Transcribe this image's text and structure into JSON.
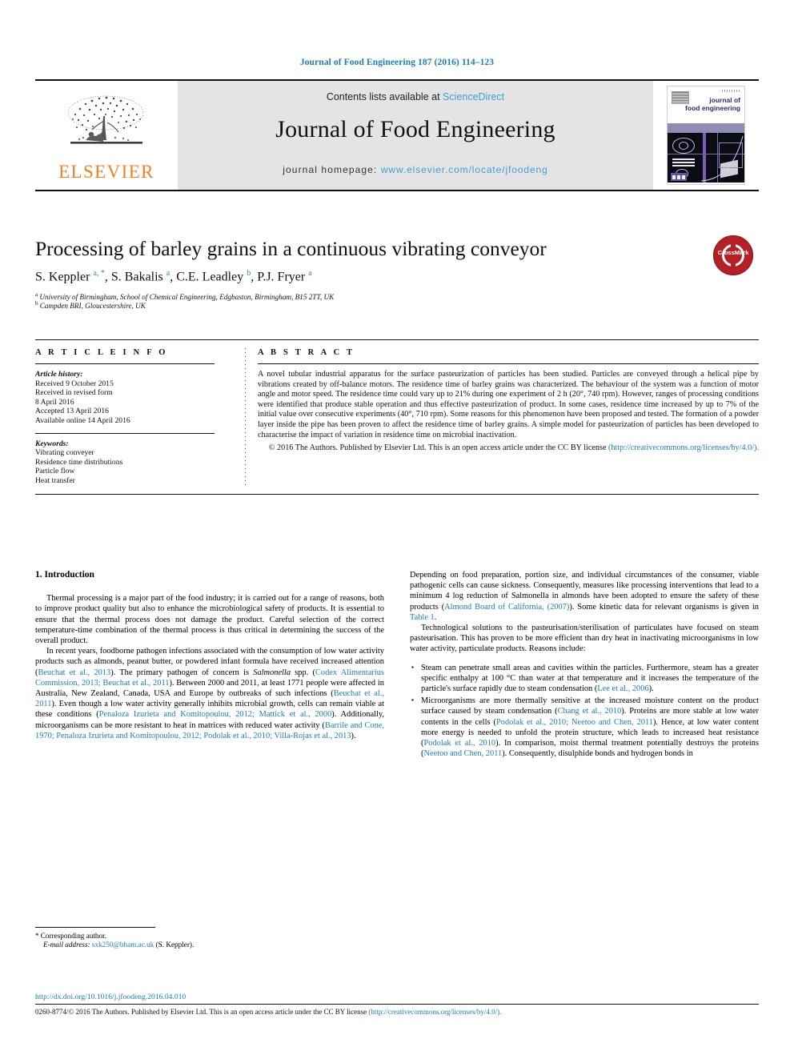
{
  "running_head": "Journal of Food Engineering 187 (2016) 114–123",
  "masthead": {
    "publisher_logo_label": "ELSEVIER",
    "contents_prefix": "Contents lists available at",
    "contents_link": "ScienceDirect",
    "journal_name": "Journal of Food Engineering",
    "homepage_prefix": "journal homepage:",
    "homepage_url": "www.elsevier.com/locate/jfoodeng",
    "cover_title_line1": "journal of",
    "cover_title_line2": "food engineering"
  },
  "article": {
    "title": "Processing of barley grains in a continuous vibrating conveyor",
    "authors_html": "S. Keppler <sup>a, *</sup>, S. Bakalis <sup>a</sup>, C.E. Leadley <sup>b</sup>, P.J. Fryer <sup>a</sup>",
    "affiliation_a": "University of Birmingham, School of Chemical Engineering, Edgbaston, Birmingham, B15 2TT, UK",
    "affiliation_b": "Campden BRI, Gloucestershire, UK",
    "crossmark_label": "CrossMark"
  },
  "article_info": {
    "heading": "A R T I C L E   I N F O",
    "history_label": "Article history:",
    "history": [
      "Received 9 October 2015",
      "Received in revised form",
      "8 April 2016",
      "Accepted 13 April 2016",
      "Available online 14 April 2016"
    ],
    "keywords_label": "Keywords:",
    "keywords": [
      "Vibrating conveyer",
      "Residence time distributions",
      "Particle flow",
      "Heat transfer"
    ]
  },
  "abstract": {
    "heading": "A B S T R A C T",
    "body": "A novel tubular industrial apparatus for the surface pasteurization of particles has been studied. Particles are conveyed through a helical pipe by vibrations created by off-balance motors. The residence time of barley grains was characterized. The behaviour of the system was a function of motor angle and motor speed. The residence time could vary up to 21% during one experiment of 2 h (20°, 740 rpm). However, ranges of processing conditions were identified that produce stable operation and thus effective pasteurization of product. In some cases, residence time increased by up to 7% of the initial value over consecutive experiments (40°, 710 rpm). Some reasons for this phenomenon have been proposed and tested. The formation of a powder layer inside the pipe has been proven to affect the residence time of barley grains. A simple model for pasteurization of particles has been developed to characterise the impact of variation in residence time on microbial inactivation.",
    "copyright_text": "© 2016 The Authors. Published by Elsevier Ltd. This is an open access article under the CC BY license",
    "license_link": "(http://creativecommons.org/licenses/by/4.0/)."
  },
  "introduction": {
    "heading": "1.  Introduction",
    "left_paragraphs": [
      {
        "segments": [
          {
            "t": "Thermal processing is a major part of the food industry; it is carried out for a range of reasons, both to improve product quality but also to enhance the microbiological safety of products. It is essential to ensure that the thermal process does not damage the product. Careful selection of the correct temperature-time combination of the thermal process is thus critical in determining the success of the overall product.",
            "s": "plain"
          }
        ]
      },
      {
        "segments": [
          {
            "t": "In recent years, foodborne pathogen infections associated with the consumption of low water activity products such as almonds, peanut butter, or powdered infant formula have received increased attention (",
            "s": "plain"
          },
          {
            "t": "Beuchat et al., 2013",
            "s": "link"
          },
          {
            "t": "). The primary pathogen of concern is ",
            "s": "plain"
          },
          {
            "t": "Salmonella",
            "s": "italic"
          },
          {
            "t": " spp. (",
            "s": "plain"
          },
          {
            "t": "Codex Alimentarius Commission, 2013; Beuchat et al., 2011",
            "s": "link"
          },
          {
            "t": "). Between 2000 and 2011, at least 1771 people were affected in Australia, New Zealand, Canada, USA and Europe by outbreaks of such infections (",
            "s": "plain"
          },
          {
            "t": "Beuchat et al., 2011",
            "s": "link"
          },
          {
            "t": "). Even though a low water activity generally inhibits microbial growth, cells can remain viable at these conditions (",
            "s": "plain"
          },
          {
            "t": "Penaloza Izurieta and Komitopoulou, 2012; Mattick et al., 2000",
            "s": "link"
          },
          {
            "t": "). Additionally, microorganisms can be more resistant to heat in matrices with reduced water activity (",
            "s": "plain"
          },
          {
            "t": "Barrile and Cone, 1970; Penaloza Izurieta and Komitopoulou, 2012; Podolak et al., 2010; Villa-Rojas et al., 2013",
            "s": "link"
          },
          {
            "t": ").",
            "s": "plain"
          }
        ]
      }
    ],
    "right_paragraphs": [
      {
        "noindent": true,
        "segments": [
          {
            "t": "Depending on food preparation, portion size, and individual circumstances of the consumer, viable pathogenic cells can cause sickness. Consequently, measures like processing interventions that lead to a minimum 4 log reduction of Salmonella in almonds have been adopted to ensure the safety of these products (",
            "s": "plain"
          },
          {
            "t": "Almond Board of California, (2007)",
            "s": "link"
          },
          {
            "t": "). Some kinetic data for relevant organisms is given in ",
            "s": "plain"
          },
          {
            "t": "Table 1",
            "s": "link"
          },
          {
            "t": ".",
            "s": "plain"
          }
        ]
      },
      {
        "segments": [
          {
            "t": "Technological solutions to the pasteurisation/sterilisation of particulates have focused on steam pasteurisation. This has proven to be more efficient than dry heat in inactivating microorganisms in low water activity, particulate products. Reasons include:",
            "s": "plain"
          }
        ]
      }
    ],
    "bullets": [
      {
        "segments": [
          {
            "t": "Steam can penetrate small areas and cavities within the particles. Furthermore, steam has a greater specific enthalpy at 100 °C than water at that temperature and it increases the temperature of the particle's surface rapidly due to steam condensation (",
            "s": "plain"
          },
          {
            "t": "Lee et al., 2006",
            "s": "link"
          },
          {
            "t": ").",
            "s": "plain"
          }
        ]
      },
      {
        "segments": [
          {
            "t": "Microorganisms are more thermally sensitive at the increased moisture content on the product surface caused by steam condensation (",
            "s": "plain"
          },
          {
            "t": "Chang et al., 2010",
            "s": "link"
          },
          {
            "t": "). Proteins are more stable at low water contents in the cells (",
            "s": "plain"
          },
          {
            "t": "Podolak et al., 2010; Neetoo and Chen, 2011",
            "s": "link"
          },
          {
            "t": "). Hence, at low water content more energy is needed to unfold the protein structure, which leads to increased heat resistance (",
            "s": "plain"
          },
          {
            "t": "Podolak et al., 2010",
            "s": "link"
          },
          {
            "t": "). In comparison, moist thermal treatment potentially destroys the proteins (",
            "s": "plain"
          },
          {
            "t": "Neetoo and Chen, 2011",
            "s": "link"
          },
          {
            "t": "). Consequently, disulphide bonds and hydrogen bonds in",
            "s": "plain"
          }
        ]
      }
    ]
  },
  "footnote": {
    "star": "*",
    "corresponding": "Corresponding author.",
    "email_label": "E-mail address:",
    "email": "sxk250@bham.ac.uk",
    "email_suffix": "(S. Keppler)."
  },
  "footer": {
    "doi": "http://dx.doi.org/10.1016/j.jfoodeng.2016.04.010",
    "issn_copyright": "0260-8774/© 2016 The Authors. Published by Elsevier Ltd. This is an open access article under the CC BY license",
    "license_url": "(http://creativecommons.org/licenses/by/4.0/)."
  },
  "colors": {
    "link": "#1a7fb5",
    "elsevier_orange": "#f08020",
    "crossmark_red": "#b42025",
    "masthead_gray": "#e4e4e4"
  }
}
